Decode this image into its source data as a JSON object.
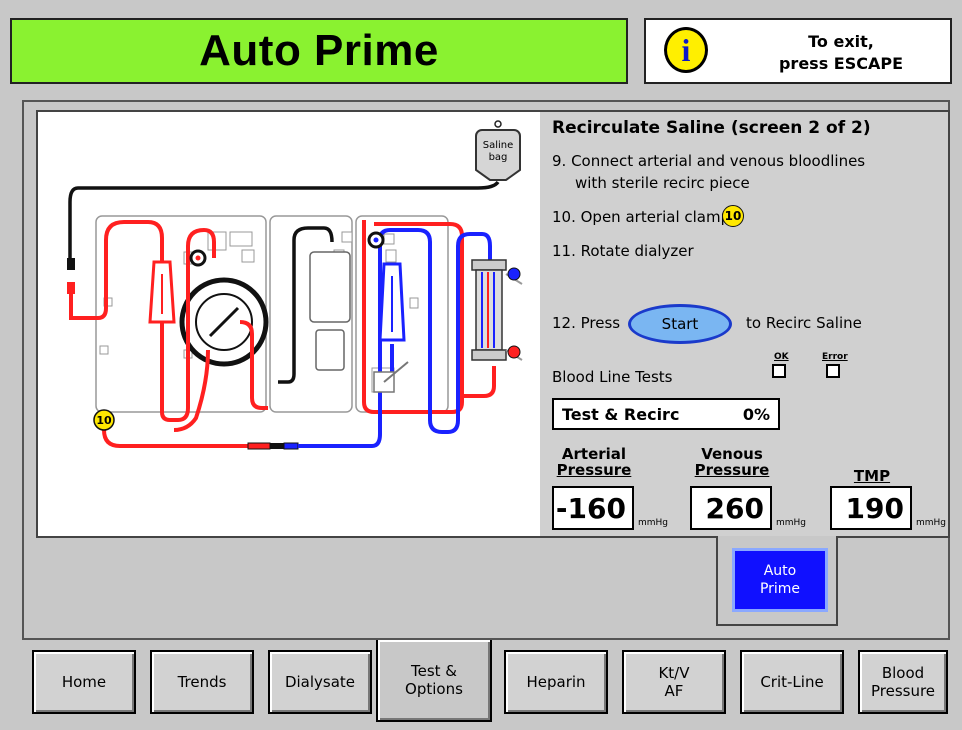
{
  "header": {
    "title": "Auto Prime",
    "info_line1": "To exit,",
    "info_line2": "press ESCAPE"
  },
  "diagram": {
    "saline_bag_label_1": "Saline",
    "saline_bag_label_2": "bag",
    "clamp_marker": "10"
  },
  "instructions": {
    "title": "Recirculate Saline  (screen 2 of 2)",
    "step9_line1": "9.  Connect arterial and venous bloodlines",
    "step9_line2": "with sterile recirc piece",
    "step10": "10.  Open arterial clamp",
    "step10_marker": "10",
    "step11": "11.  Rotate dialyzer",
    "step12_prefix": "12.  Press",
    "step12_suffix": "to Recirc Saline",
    "start_label": "Start"
  },
  "blood_line_tests": {
    "label": "Blood Line Tests",
    "ok_label": "OK",
    "error_label": "Error"
  },
  "progress": {
    "label": "Test  &  Recirc",
    "value": "0%"
  },
  "pressures": {
    "arterial_label_1": "Arterial",
    "arterial_label_2": "Pressure",
    "arterial_value": "-160",
    "venous_label_1": "Venous",
    "venous_label_2": "Pressure",
    "venous_value": "260",
    "tmp_label": "TMP",
    "tmp_value": "190",
    "unit": "mmHg"
  },
  "auto_prime_button": "Auto\nPrime",
  "tabs": [
    {
      "label": "Home"
    },
    {
      "label": "Trends"
    },
    {
      "label": "Dialysate"
    },
    {
      "label": "Test &\nOptions"
    },
    {
      "label": "Heparin"
    },
    {
      "label": "Kt/V\nAF"
    },
    {
      "label": "Crit-Line"
    },
    {
      "label": "Blood\nPressure"
    }
  ],
  "colors": {
    "title_green": "#8af230",
    "arterial_red": "#ff2020",
    "venous_blue": "#1a22ff",
    "button_blue": "#1010ff"
  }
}
